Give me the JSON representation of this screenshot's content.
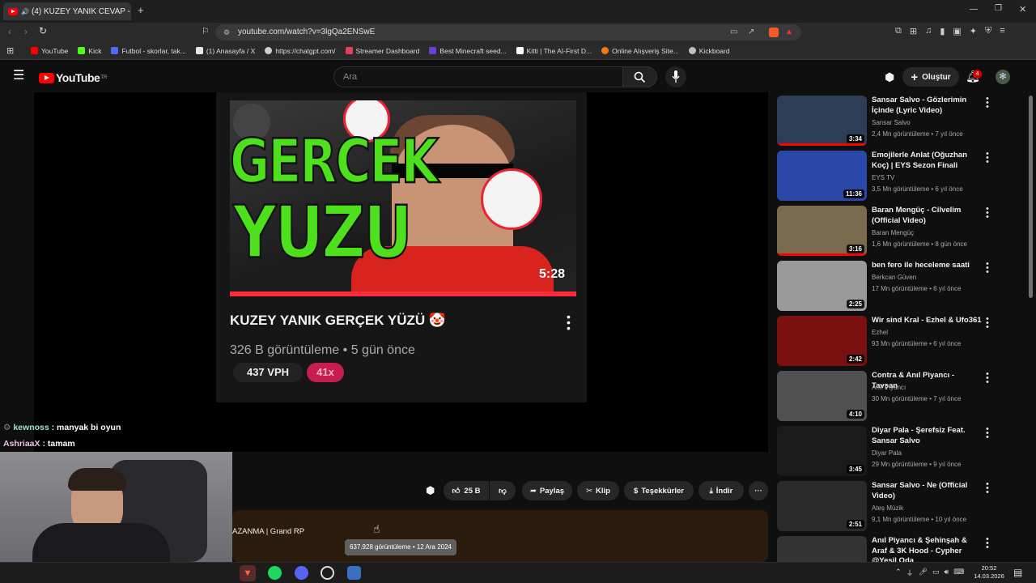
{
  "browser": {
    "tab_title": "(4) KUZEY YANIK CEVAP - You",
    "url": "youtube.com/watch?v=3lgQa2ENSwE",
    "bookmarks": [
      {
        "label": "YouTube",
        "color": "#ff0000"
      },
      {
        "label": "Kick",
        "color": "#53fc18"
      },
      {
        "label": "Futbol - skorlar, tak...",
        "color": "#4a6cf7"
      },
      {
        "label": "(1) Anasayfa / X",
        "color": "#e7e7e7"
      },
      {
        "label": "https://chatgpt.com/",
        "color": "#d0d0d0"
      },
      {
        "label": "Streamer Dashboard",
        "color": "#e0405a"
      },
      {
        "label": "Best Minecraft seed...",
        "color": "#6b3fd4"
      },
      {
        "label": "Kitti | The AI-First D...",
        "color": "#ffffff"
      },
      {
        "label": "Online Alışveriş Site...",
        "color": "#f27a1a"
      },
      {
        "label": "Kickboard",
        "color": "#c0c0c0"
      }
    ]
  },
  "youtube": {
    "logo": "YouTube",
    "logo_region": "TR",
    "search_placeholder": "Ara",
    "create_label": "Oluştur",
    "notification_count": "4"
  },
  "endscreen": {
    "thumb_text_line1": "GERCEK",
    "thumb_text_line2": "YUZU",
    "duration": "5:28",
    "title": "KUZEY YANIK GERÇEK YÜZÜ 🤡",
    "views_line": "326 B görüntüleme • 5 gün önce",
    "vph": "437 VPH",
    "multiplier": "41x"
  },
  "actions": {
    "likes": "25 B",
    "share": "Paylaş",
    "clip": "Klip",
    "thanks": "Teşekkürler",
    "download": "İndir"
  },
  "description": {
    "partial_text": "AZANMA | Grand RP",
    "tooltip": "637.928 görüntüleme • 12 Ara 2024"
  },
  "chat": [
    {
      "user": "kewnoss",
      "text": " : manyak bi oyun",
      "color": "#9fe8c8"
    },
    {
      "user": "AshriaaX",
      "text": " : tamam",
      "color": "#f1c1e6"
    }
  ],
  "sidebar": [
    {
      "title": "Sansar Salvo - Gözlerimin İçinde (Lyric Video)",
      "channel": "Sansar Salvo",
      "meta": "2,4 Mn görüntüleme • 7 yıl önce",
      "duration": "3:34",
      "thumb": "#2c3e56",
      "progress": true
    },
    {
      "title": "Emojilerle Anlat (Oğuzhan Koç) | EYS Sezon Finali",
      "channel": "EYS TV",
      "meta": "3,5 Mn görüntüleme • 6 yıl önce",
      "duration": "11:36",
      "thumb": "#2b47a8",
      "progress": false
    },
    {
      "title": "Baran Mengüç - Cilvelim (Official Video)",
      "channel": "Baran Mengüç",
      "meta": "1,6 Mn görüntüleme • 8 gün önce",
      "duration": "3:16",
      "thumb": "#7a6a4e",
      "progress": true
    },
    {
      "title": "ben fero ile heceleme saati",
      "channel": "Berkcan Güven",
      "meta": "17 Mn görüntüleme • 6 yıl önce",
      "duration": "2:25",
      "thumb": "#9a9a9a",
      "progress": false
    },
    {
      "title": "Wir sind Kral - Ezhel & Ufo361",
      "channel": "Ezhel",
      "meta": "93 Mn görüntüleme • 6 yıl önce",
      "duration": "2:42",
      "thumb": "#7a1010",
      "progress": false
    },
    {
      "title": "Contra & Anıl Piyancı - Tavşan",
      "channel": "Anıl Piyancı",
      "meta": "30 Mn görüntüleme • 7 yıl önce",
      "duration": "4:10",
      "thumb": "#505050",
      "progress": false
    },
    {
      "title": "Diyar Pala - Şerefsiz Feat. Sansar Salvo",
      "channel": "Diyar Pala",
      "meta": "29 Mn görüntüleme • 9 yıl önce",
      "duration": "3:45",
      "thumb": "#1a1a1a",
      "progress": false
    },
    {
      "title": "Sansar Salvo - Ne (Official Video)",
      "channel": "Ateş Müzik",
      "meta": "9,1 Mn görüntüleme • 10 yıl önce",
      "duration": "2:51",
      "thumb": "#2a2a2a",
      "progress": false
    },
    {
      "title": "Anıl Piyancı & Şehinşah & Araf & 3K Hood - Cypher @Yeşil Oda",
      "channel": "",
      "meta": "",
      "duration": "",
      "thumb": "#333333",
      "progress": false
    }
  ],
  "taskbar": {
    "time": "20:52",
    "date": "14.03.2026"
  }
}
